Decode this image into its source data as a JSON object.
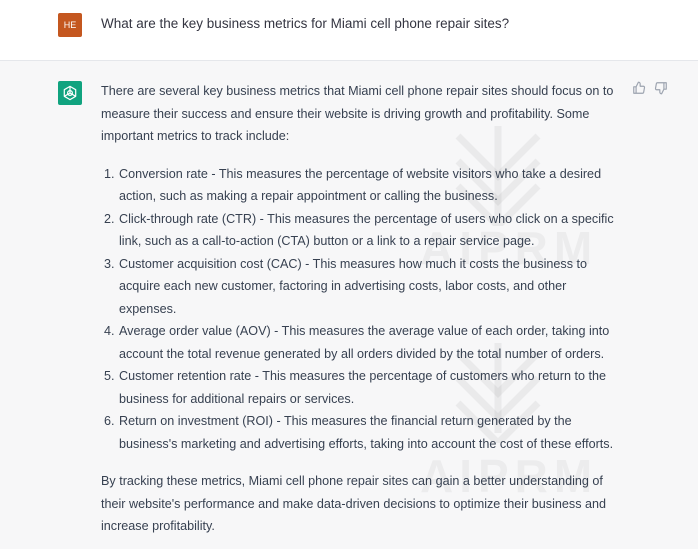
{
  "user": {
    "initials": "HE",
    "avatar_color": "#c4571f",
    "message": "What are the key business metrics for Miami cell phone repair sites?"
  },
  "assistant": {
    "avatar_icon": "openai-logo-icon",
    "avatar_color": "#10a37f",
    "intro": "There are several key business metrics that Miami cell phone repair sites should focus on to measure their success and ensure their website is driving growth and profitability. Some important metrics to track include:",
    "metrics": [
      "Conversion rate - This measures the percentage of website visitors who take a desired action, such as making a repair appointment or calling the business.",
      "Click-through rate (CTR) - This measures the percentage of users who click on a specific link, such as a call-to-action (CTA) button or a link to a repair service page.",
      "Customer acquisition cost (CAC) - This measures how much it costs the business to acquire each new customer, factoring in advertising costs, labor costs, and other expenses.",
      "Average order value (AOV) - This measures the average value of each order, taking into account the total revenue generated by all orders divided by the total number of orders.",
      "Customer retention rate - This measures the percentage of customers who return to the business for additional repairs or services.",
      "Return on investment (ROI) - This measures the financial return generated by the business's marketing and advertising efforts, taking into account the cost of these efforts."
    ],
    "conclusion": "By tracking these metrics, Miami cell phone repair sites can gain a better understanding of their website's performance and make data-driven decisions to optimize their business and increase profitability."
  },
  "feedback": {
    "thumbs_up_icon": "thumbs-up-icon",
    "thumbs_down_icon": "thumbs-down-icon"
  },
  "watermark": {
    "text": "AIPRM"
  }
}
